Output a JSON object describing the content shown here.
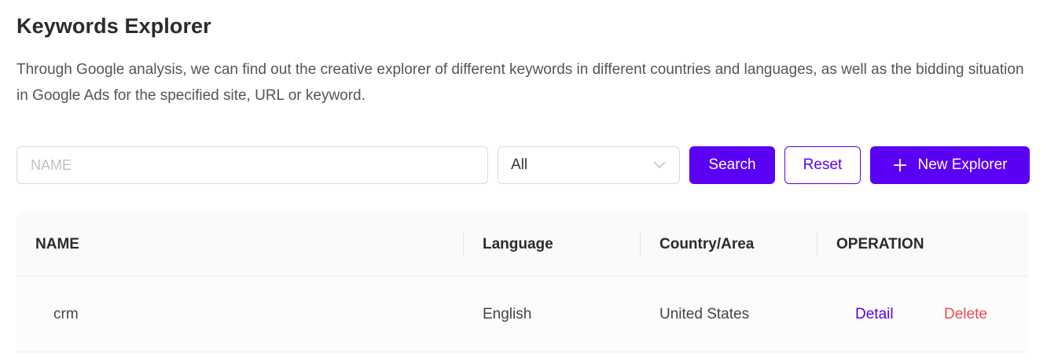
{
  "header": {
    "title": "Keywords Explorer",
    "description": "Through Google analysis, we can find out the creative explorer of different keywords in different countries and languages, as well as the bidding situation in Google Ads for the specified site, URL or keyword."
  },
  "filters": {
    "name_placeholder": "NAME",
    "name_value": "",
    "select_value": "All",
    "search_label": "Search",
    "reset_label": "Reset",
    "new_label": "New Explorer"
  },
  "table": {
    "columns": [
      "NAME",
      "Language",
      "Country/Area",
      "OPERATION"
    ],
    "rows": [
      {
        "name": "crm",
        "language": "English",
        "country": "United States",
        "actions": [
          "Detail",
          "Delete"
        ]
      }
    ]
  },
  "colors": {
    "primary": "#5a00f5",
    "danger": "#f5474f",
    "header_bg": "#f9fafa"
  }
}
